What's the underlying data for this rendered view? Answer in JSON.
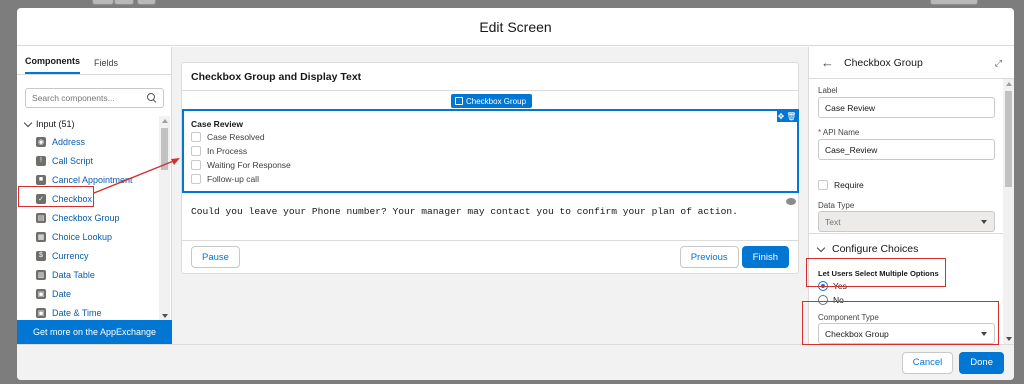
{
  "modal": {
    "title": "Edit Screen"
  },
  "left_panel": {
    "tabs": [
      "Components",
      "Fields"
    ],
    "search_placeholder": "Search components...",
    "section_label": "Input (51)",
    "items": [
      {
        "label": "Address",
        "icon": "address-icon"
      },
      {
        "label": "Call Script",
        "icon": "call-script-icon"
      },
      {
        "label": "Cancel Appointment",
        "icon": "cancel-appointment-icon"
      },
      {
        "label": "Checkbox",
        "icon": "checkbox-icon"
      },
      {
        "label": "Checkbox Group",
        "icon": "checkbox-group-icon"
      },
      {
        "label": "Choice Lookup",
        "icon": "choice-lookup-icon"
      },
      {
        "label": "Currency",
        "icon": "currency-icon"
      },
      {
        "label": "Data Table",
        "icon": "data-table-icon"
      },
      {
        "label": "Date",
        "icon": "date-icon"
      },
      {
        "label": "Date & Time",
        "icon": "datetime-icon"
      }
    ],
    "appexchange_label": "Get more on the AppExchange"
  },
  "canvas": {
    "screen_title": "Checkbox Group and Display Text",
    "selected_badge": "Checkbox Group",
    "checkbox_group": {
      "label": "Case Review",
      "options": [
        "Case Resolved",
        "In Process",
        "Waiting For Response",
        "Follow-up call"
      ]
    },
    "display_text": "Could you leave your Phone number? Your manager may contact you to confirm your plan of action.",
    "footer": {
      "pause": "Pause",
      "previous": "Previous",
      "finish": "Finish"
    }
  },
  "right_panel": {
    "title": "Checkbox Group",
    "label_field": {
      "label": "Label",
      "value": "Case Review"
    },
    "api_name_field": {
      "required_mark": "*",
      "label": "API Name",
      "value": "Case_Review"
    },
    "require_label": "Require",
    "data_type": {
      "label": "Data Type",
      "value": "Text"
    },
    "configure_choices": "Configure Choices",
    "multi_select": {
      "label": "Let Users Select Multiple Options",
      "yes": "Yes",
      "no": "No",
      "selected": "Yes"
    },
    "component_type": {
      "label": "Component Type",
      "value": "Checkbox Group"
    }
  },
  "footer": {
    "cancel": "Cancel",
    "done": "Done"
  },
  "colors": {
    "brand": "#0176d3",
    "annotation": "#d32f2f",
    "backdrop": "#7d7d7d"
  }
}
